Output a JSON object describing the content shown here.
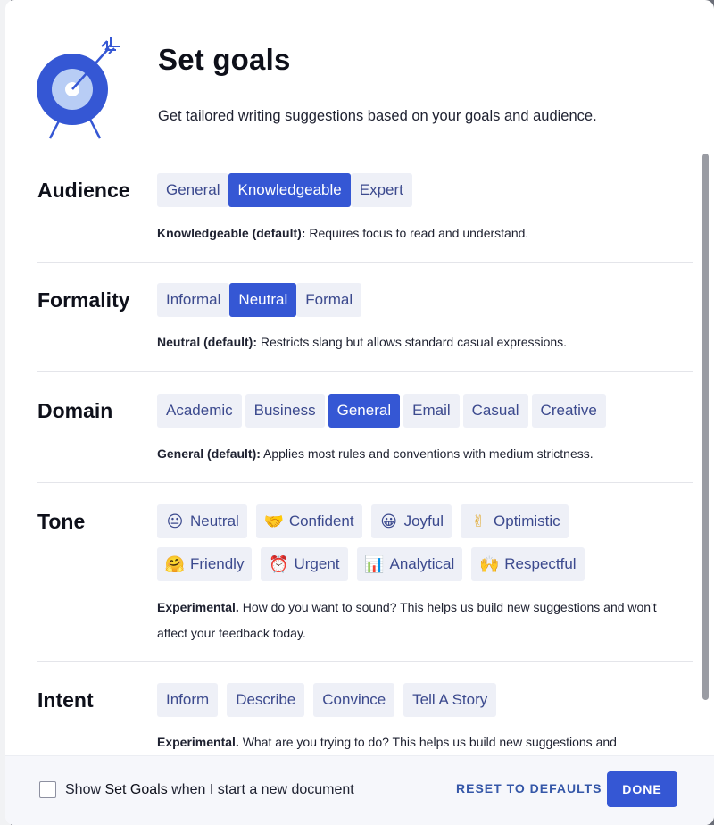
{
  "header": {
    "title": "Set goals",
    "subtitle": "Get tailored writing suggestions based on your goals and audience.",
    "illustration_icon": "target-arrow-icon"
  },
  "colors": {
    "accent": "#3557d4",
    "chip_bg": "#eef0f7",
    "chip_text": "#3c4a8e",
    "target_light": "#b8cdf5"
  },
  "sections": {
    "audience": {
      "label": "Audience",
      "options": [
        "General",
        "Knowledgeable",
        "Expert"
      ],
      "selected": "Knowledgeable",
      "desc_strong": "Knowledgeable (default):",
      "desc": " Requires focus to read and understand."
    },
    "formality": {
      "label": "Formality",
      "options": [
        "Informal",
        "Neutral",
        "Formal"
      ],
      "selected": "Neutral",
      "desc_strong": "Neutral (default):",
      "desc": " Restricts slang but allows standard casual expressions."
    },
    "domain": {
      "label": "Domain",
      "options": [
        "Academic",
        "Business",
        "General",
        "Email",
        "Casual",
        "Creative"
      ],
      "selected": "General",
      "desc_strong": "General (default):",
      "desc": " Applies most rules and conventions with medium strictness."
    },
    "tone": {
      "label": "Tone",
      "row1": [
        {
          "label": "Neutral",
          "emoji": "😐",
          "icon": "neutral-face-icon"
        },
        {
          "label": "Confident",
          "emoji": "🤝",
          "icon": "handshake-icon"
        },
        {
          "label": "Joyful",
          "emoji": "😀",
          "icon": "grinning-face-icon"
        },
        {
          "label": "Optimistic",
          "emoji": "✌",
          "icon": "victory-hand-icon"
        }
      ],
      "row2": [
        {
          "label": "Friendly",
          "emoji": "🤗",
          "icon": "hugging-face-icon"
        },
        {
          "label": "Urgent",
          "emoji": "⏰",
          "icon": "alarm-clock-icon"
        },
        {
          "label": "Analytical",
          "emoji": "📊",
          "icon": "bar-chart-icon"
        },
        {
          "label": "Respectful",
          "emoji": "🙌",
          "icon": "raised-hands-icon"
        }
      ],
      "desc_strong": "Experimental.",
      "desc": " How do you want to sound? This helps us build new suggestions and won't affect your feedback today."
    },
    "intent": {
      "label": "Intent",
      "options": [
        "Inform",
        "Describe",
        "Convince",
        "Tell A Story"
      ],
      "desc_strong": "Experimental.",
      "desc": " What are you trying to do? This helps us build new suggestions and"
    }
  },
  "footer": {
    "checkbox_prefix": "Show ",
    "checkbox_strong": "Set Goals",
    "checkbox_suffix": " when I start a new document",
    "checkbox_checked": false,
    "reset_label": "RESET TO DEFAULTS",
    "done_label": "DONE"
  }
}
